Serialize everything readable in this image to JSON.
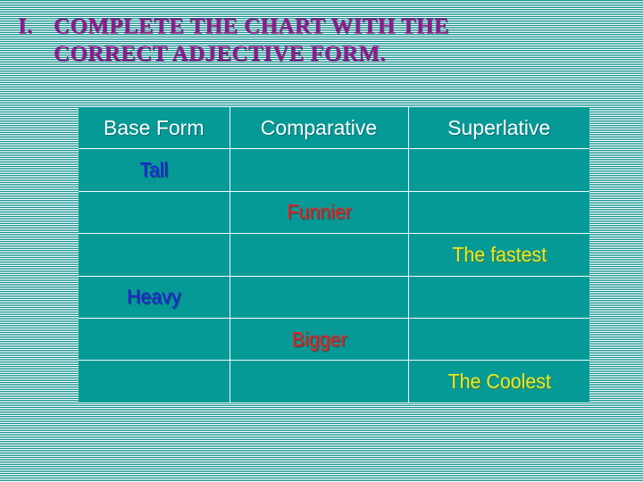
{
  "slide": {
    "background_color": "#ffffff",
    "pattern_color": "#0b8f8c"
  },
  "title": {
    "number": "I.",
    "line1": "COMPLETE THE CHART WITH THE",
    "line2": "CORRECT ADJECTIVE FORM.",
    "color": "#8d1a8d"
  },
  "table": {
    "fill_color": "#069a97",
    "grid_color": "#f2fbfb",
    "headers": [
      "Base Form",
      "Comparative",
      "Superlative"
    ],
    "rows": [
      {
        "base": "Tall",
        "comparative": "",
        "superlative": ""
      },
      {
        "base": "",
        "comparative": "Funnier",
        "superlative": ""
      },
      {
        "base": "",
        "comparative": "",
        "superlative": "The fastest"
      },
      {
        "base": "Heavy",
        "comparative": "",
        "superlative": ""
      },
      {
        "base": "",
        "comparative": "Bigger",
        "superlative": ""
      },
      {
        "base": "",
        "comparative": "",
        "superlative": "The Coolest"
      }
    ]
  }
}
